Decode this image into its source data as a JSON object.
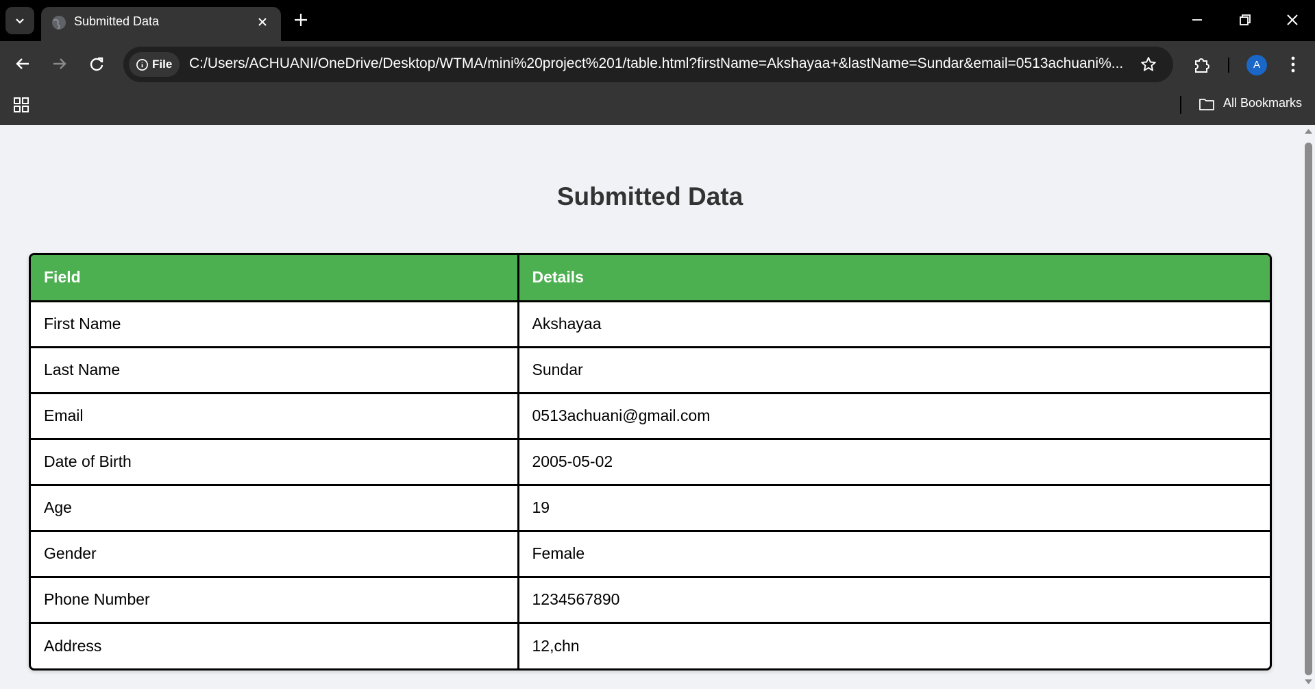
{
  "browser": {
    "tab_title": "Submitted Data",
    "url_chip": "File",
    "url": "C:/Users/ACHUANI/OneDrive/Desktop/WTMA/mini%20project%201/table.html?firstName=Akshayaa+&lastName=Sundar&email=0513achuani%...",
    "profile_initial": "A",
    "bookmarks_label": "All Bookmarks"
  },
  "page": {
    "heading": "Submitted Data",
    "table": {
      "headers": [
        "Field",
        "Details"
      ],
      "rows": [
        [
          "First Name",
          "Akshayaa"
        ],
        [
          "Last Name",
          "Sundar"
        ],
        [
          "Email",
          "0513achuani@gmail.com"
        ],
        [
          "Date of Birth",
          "2005-05-02"
        ],
        [
          "Age",
          "19"
        ],
        [
          "Gender",
          "Female"
        ],
        [
          "Phone Number",
          "1234567890"
        ],
        [
          "Address",
          "12,chn"
        ]
      ]
    }
  },
  "colors": {
    "header_green": "#4caf50",
    "page_bg": "#f0f2f5",
    "chrome_dark": "#353535"
  },
  "icons": [
    "chevron-down-icon",
    "globe-icon",
    "close-icon",
    "plus-icon",
    "minimize-icon",
    "restore-icon",
    "back-icon",
    "forward-icon",
    "reload-icon",
    "info-icon",
    "star-icon",
    "extensions-icon",
    "more-icon",
    "apps-icon",
    "folder-icon"
  ]
}
